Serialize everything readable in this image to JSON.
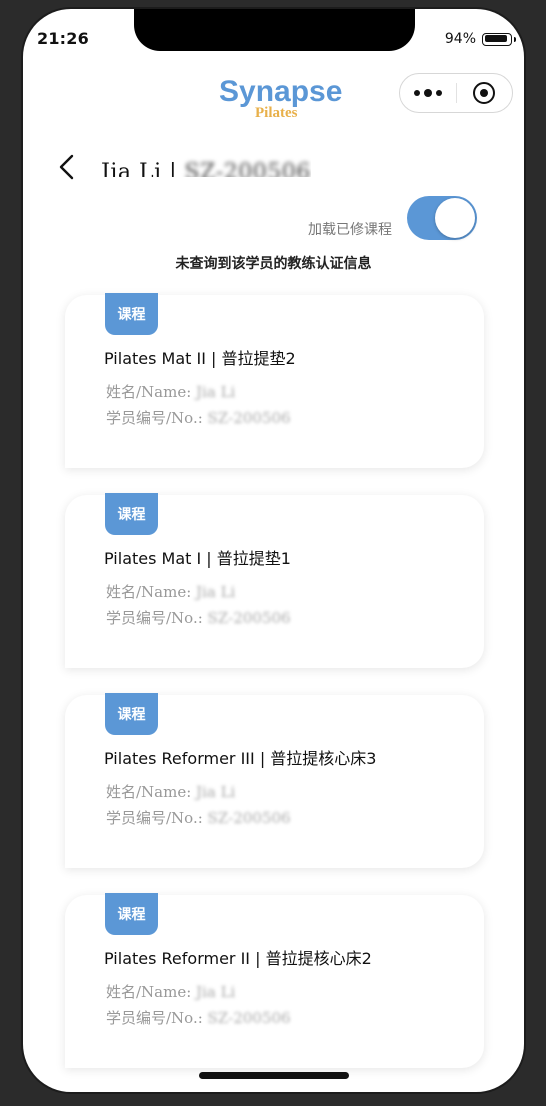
{
  "status": {
    "time": "21:26",
    "battery": "94%",
    "battery_level": 0.94
  },
  "header": {
    "logo_main": "Synapse",
    "logo_sub": "Pilates",
    "more_icon": "more-dots-icon",
    "close_icon": "target-close-icon"
  },
  "page": {
    "title_name": "Jia Li | ",
    "title_id": "SZ-200506",
    "toggle_label": "加载已修课程",
    "toggle_on": true,
    "notice": "未查询到该学员的教练认证信息"
  },
  "colors": {
    "accent": "#5b97d6"
  },
  "courses": [
    {
      "tag": "课程",
      "title": "Pilates Mat II | 普拉提垫2",
      "name_label": "姓名/Name: ",
      "name_value": "Jia Li",
      "no_label": "学员编号/No.: ",
      "no_value": "SZ-200506"
    },
    {
      "tag": "课程",
      "title": "Pilates Mat I | 普拉提垫1",
      "name_label": "姓名/Name: ",
      "name_value": "Jia Li",
      "no_label": "学员编号/No.: ",
      "no_value": "SZ-200506"
    },
    {
      "tag": "课程",
      "title": "Pilates Reformer III | 普拉提核心床3",
      "name_label": "姓名/Name: ",
      "name_value": "Jia Li",
      "no_label": "学员编号/No.: ",
      "no_value": "SZ-200506"
    },
    {
      "tag": "课程",
      "title": "Pilates Reformer II | 普拉提核心床2",
      "name_label": "姓名/Name: ",
      "name_value": "Jia Li",
      "no_label": "学员编号/No.: ",
      "no_value": "SZ-200506"
    }
  ]
}
